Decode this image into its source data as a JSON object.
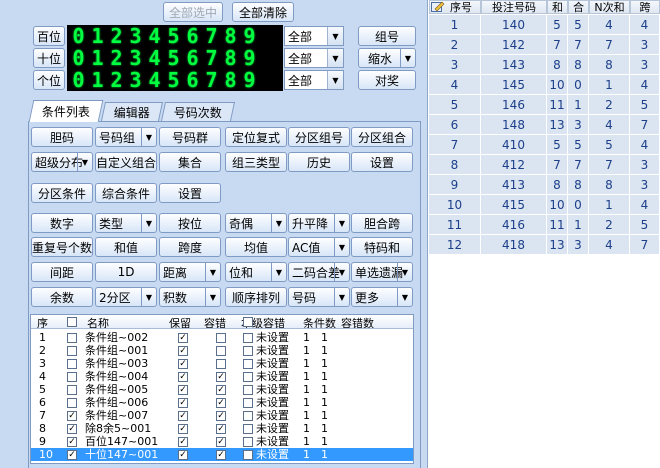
{
  "top_buttons": {
    "select_all": "全部选中",
    "clear_all": "全部清除"
  },
  "digit_rows": [
    {
      "label": "百位",
      "digits": "0123456789",
      "select": "全部",
      "side": "组号",
      "side_split": false
    },
    {
      "label": "十位",
      "digits": "0123456789",
      "select": "全部",
      "side": "缩水",
      "side_split": true
    },
    {
      "label": "个位",
      "digits": "0123456789",
      "select": "全部",
      "side": "对奖",
      "side_split": false
    }
  ],
  "tabs": [
    "条件列表",
    "编辑器",
    "号码次数"
  ],
  "button_rows_a": [
    [
      {
        "t": "胆码",
        "s": false
      },
      {
        "t": "号码组",
        "s": true
      },
      {
        "t": "号码群",
        "s": false
      },
      {
        "t": "定位复式",
        "s": false
      },
      {
        "t": "分区组号",
        "s": false
      },
      {
        "t": "分区组合",
        "s": false
      }
    ],
    [
      {
        "t": "超级分布",
        "s": true
      },
      {
        "t": "自定义组合",
        "s": false
      },
      {
        "t": "集合",
        "s": false
      },
      {
        "t": "组三类型",
        "s": false
      },
      {
        "t": "历史",
        "s": false
      },
      {
        "t": "设置",
        "s": false
      }
    ]
  ],
  "button_row_b": [
    "分区条件",
    "综合条件",
    "设置"
  ],
  "button_rows_c": [
    [
      {
        "t": "数字",
        "s": false
      },
      {
        "t": "类型",
        "s": true
      },
      {
        "t": "按位",
        "s": false
      },
      {
        "t": "奇偶",
        "s": true
      },
      {
        "t": "升平降",
        "s": true
      },
      {
        "t": "胆合跨",
        "s": false
      }
    ],
    [
      {
        "t": "重复号个数",
        "s": false
      },
      {
        "t": "和值",
        "s": false
      },
      {
        "t": "跨度",
        "s": false
      },
      {
        "t": "均值",
        "s": false
      },
      {
        "t": "AC值",
        "s": true
      },
      {
        "t": "特码和",
        "s": false
      }
    ],
    [
      {
        "t": "间距",
        "s": false
      },
      {
        "t": "1D",
        "s": false
      },
      {
        "t": "距离",
        "s": true
      },
      {
        "t": "位和",
        "s": true
      },
      {
        "t": "二码合差",
        "s": true
      },
      {
        "t": "单选遗漏",
        "s": true
      }
    ],
    [
      {
        "t": "余数",
        "s": false
      },
      {
        "t": "2分区",
        "s": true
      },
      {
        "t": "积数",
        "s": true
      },
      {
        "t": "顺序排列",
        "s": false
      },
      {
        "t": "号码",
        "s": true
      },
      {
        "t": "更多",
        "s": true
      }
    ]
  ],
  "cond_table": {
    "headers": [
      "序",
      "名称",
      "保留",
      "容错",
      "本级容错",
      "条件数",
      "容错数"
    ],
    "rows": [
      {
        "no": "1",
        "checked": false,
        "name": "条件组~002",
        "keep": true,
        "tol": false,
        "local": "未设置",
        "count": "1",
        "tolcount": "1"
      },
      {
        "no": "2",
        "checked": false,
        "name": "条件组~001",
        "keep": true,
        "tol": false,
        "local": "未设置",
        "count": "1",
        "tolcount": "1"
      },
      {
        "no": "3",
        "checked": false,
        "name": "条件组~003",
        "keep": true,
        "tol": false,
        "local": "未设置",
        "count": "1",
        "tolcount": "1"
      },
      {
        "no": "4",
        "checked": false,
        "name": "条件组~004",
        "keep": true,
        "tol": true,
        "local": "未设置",
        "count": "1",
        "tolcount": "1"
      },
      {
        "no": "5",
        "checked": false,
        "name": "条件组~005",
        "keep": true,
        "tol": true,
        "local": "未设置",
        "count": "1",
        "tolcount": "1"
      },
      {
        "no": "6",
        "checked": false,
        "name": "条件组~006",
        "keep": true,
        "tol": true,
        "local": "未设置",
        "count": "1",
        "tolcount": "1"
      },
      {
        "no": "7",
        "checked": true,
        "name": "条件组~007",
        "keep": true,
        "tol": true,
        "local": "未设置",
        "count": "1",
        "tolcount": "1"
      },
      {
        "no": "8",
        "checked": true,
        "name": "除8余5~001",
        "keep": true,
        "tol": true,
        "local": "未设置",
        "count": "1",
        "tolcount": "1"
      },
      {
        "no": "9",
        "checked": true,
        "name": "百位147~001",
        "keep": true,
        "tol": true,
        "local": "未设置",
        "count": "1",
        "tolcount": "1"
      },
      {
        "no": "10",
        "checked": true,
        "name": "十位147~001",
        "keep": true,
        "tol": true,
        "local": "未设置",
        "count": "1",
        "tolcount": "1"
      }
    ]
  },
  "results": {
    "headers": [
      "序号",
      "投注号码",
      "和",
      "合",
      "N次和",
      "跨"
    ],
    "rows": [
      [
        "1",
        "140",
        "5",
        "5",
        "4",
        "4"
      ],
      [
        "2",
        "142",
        "7",
        "7",
        "7",
        "3"
      ],
      [
        "3",
        "143",
        "8",
        "8",
        "8",
        "3"
      ],
      [
        "4",
        "145",
        "10",
        "0",
        "1",
        "4"
      ],
      [
        "5",
        "146",
        "11",
        "1",
        "2",
        "5"
      ],
      [
        "6",
        "148",
        "13",
        "3",
        "4",
        "7"
      ],
      [
        "7",
        "410",
        "5",
        "5",
        "5",
        "4"
      ],
      [
        "8",
        "412",
        "7",
        "7",
        "7",
        "3"
      ],
      [
        "9",
        "413",
        "8",
        "8",
        "8",
        "3"
      ],
      [
        "10",
        "415",
        "10",
        "0",
        "1",
        "4"
      ],
      [
        "11",
        "416",
        "11",
        "1",
        "2",
        "5"
      ],
      [
        "12",
        "418",
        "13",
        "3",
        "4",
        "7"
      ]
    ]
  }
}
